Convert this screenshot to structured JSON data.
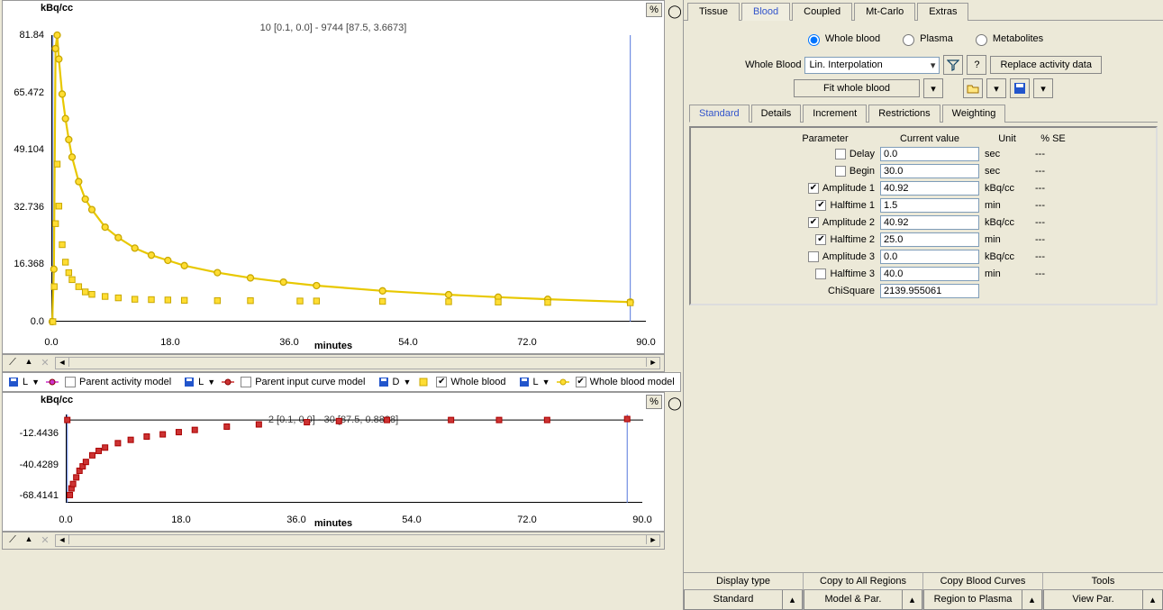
{
  "chart1": {
    "ylabel": "kBq/cc",
    "subtitle": "10 [0.1, 0.0] - 9744 [87.5, 3.6673]",
    "xlabel": "minutes",
    "yticks": [
      "81.84",
      "65.472",
      "49.104",
      "32.736",
      "16.368",
      "0.0"
    ],
    "xticks": [
      "0.0",
      "18.0",
      "36.0",
      "54.0",
      "72.0",
      "90.0"
    ],
    "xrange": [
      0,
      90
    ],
    "yrange": [
      0,
      81.84
    ]
  },
  "chart2": {
    "ylabel": "kBq/cc",
    "subtitle": "2 [0.1, 0.0] - 30 [87.5, 0.8808]",
    "xlabel": "minutes",
    "yticks": [
      "-12.4436",
      "-40.4289",
      "-68.4141"
    ],
    "xticks": [
      "0.0",
      "18.0",
      "36.0",
      "54.0",
      "72.0",
      "90.0"
    ],
    "xrange": [
      0,
      90
    ],
    "yrange": [
      -75,
      5
    ]
  },
  "chart_data": [
    {
      "type": "line",
      "name": "Whole blood model",
      "xlabel": "minutes",
      "ylabel": "kBq/cc",
      "xlim": [
        0,
        90
      ],
      "ylim": [
        0,
        81.84
      ],
      "x": [
        0,
        0.25,
        0.5,
        0.75,
        1,
        1.5,
        2,
        2.5,
        3,
        4,
        5,
        6,
        8,
        10,
        12.5,
        15,
        17.5,
        20,
        25,
        30,
        35,
        40,
        50,
        60,
        67.5,
        75,
        87.5
      ],
      "y": [
        0,
        15,
        78,
        81.84,
        75,
        65,
        58,
        52,
        47,
        40,
        35,
        32,
        27,
        24,
        21,
        19,
        17.5,
        16,
        14,
        12.5,
        11.3,
        10.3,
        8.8,
        7.7,
        7.0,
        6.4,
        5.6
      ]
    },
    {
      "type": "scatter",
      "name": "Whole blood",
      "x": [
        0.1,
        0.3,
        0.5,
        0.75,
        1,
        1.5,
        2,
        2.5,
        3,
        4,
        5,
        6,
        8,
        10,
        12.5,
        15,
        17.5,
        20,
        25,
        30,
        37.5,
        40,
        50,
        60,
        67.5,
        75,
        87.5
      ],
      "y": [
        0,
        10,
        28,
        45,
        33,
        22,
        17,
        14,
        12,
        10,
        8.5,
        7.8,
        7.2,
        6.8,
        6.4,
        6.3,
        6.2,
        6.1,
        6.0,
        6.0,
        5.9,
        5.9,
        5.8,
        5.7,
        5.6,
        5.5,
        5.4
      ]
    },
    {
      "type": "scatter",
      "name": "residuals",
      "xlabel": "minutes",
      "ylabel": "kBq/cc",
      "xlim": [
        0,
        90
      ],
      "ylim": [
        -75,
        5
      ],
      "x": [
        0.1,
        0.5,
        0.75,
        1,
        1.5,
        2,
        2.5,
        3,
        4,
        5,
        6,
        8,
        10,
        12.5,
        15,
        17.5,
        20,
        25,
        30,
        37.5,
        42.5,
        50,
        60,
        67.5,
        75,
        87.5
      ],
      "y": [
        0,
        -68,
        -62,
        -58,
        -52,
        -46,
        -42,
        -38,
        -32,
        -28,
        -25,
        -21,
        -18,
        -15,
        -13,
        -11,
        -9,
        -6,
        -4,
        -2,
        -1,
        0,
        0,
        0,
        0,
        0.88
      ]
    }
  ],
  "legend": [
    {
      "disk": "L",
      "checked": false,
      "label": "Parent activity model",
      "marker": "dot-magenta"
    },
    {
      "disk": "L",
      "checked": false,
      "label": "Parent input curve model",
      "marker": "dot-red"
    },
    {
      "disk": "D",
      "checked": true,
      "label": "Whole blood",
      "marker": "sq-yellow"
    },
    {
      "disk": "L",
      "checked": true,
      "label": "Whole blood model",
      "marker": "dot-yellow"
    }
  ],
  "tabs": [
    "Tissue",
    "Blood",
    "Coupled",
    "Mt-Carlo",
    "Extras"
  ],
  "active_tab": "Blood",
  "radios": [
    "Whole blood",
    "Plasma",
    "Metabolites"
  ],
  "radio_sel": "Whole blood",
  "wb_label": "Whole Blood",
  "wb_method": "Lin. Interpolation",
  "replace_btn": "Replace activity data",
  "fit_btn": "Fit whole blood",
  "subtabs": [
    "Standard",
    "Details",
    "Increment",
    "Restrictions",
    "Weighting"
  ],
  "active_subtab": "Standard",
  "param_hdr": [
    "Parameter",
    "Current value",
    "Unit",
    "% SE"
  ],
  "params": [
    {
      "name": "Delay",
      "chk": false,
      "val": "0.0",
      "unit": "sec",
      "se": "---"
    },
    {
      "name": "Begin",
      "chk": false,
      "val": "30.0",
      "unit": "sec",
      "se": "---"
    },
    {
      "name": "Amplitude 1",
      "chk": true,
      "val": "40.92",
      "unit": "kBq/cc",
      "se": "---"
    },
    {
      "name": "Halftime 1",
      "chk": true,
      "val": "1.5",
      "unit": "min",
      "se": "---"
    },
    {
      "name": "Amplitude 2",
      "chk": true,
      "val": "40.92",
      "unit": "kBq/cc",
      "se": "---"
    },
    {
      "name": "Halftime 2",
      "chk": true,
      "val": "25.0",
      "unit": "min",
      "se": "---"
    },
    {
      "name": "Amplitude 3",
      "chk": false,
      "val": "0.0",
      "unit": "kBq/cc",
      "se": "---"
    },
    {
      "name": "Halftime 3",
      "chk": false,
      "val": "40.0",
      "unit": "min",
      "se": "---"
    }
  ],
  "chisq_label": "ChiSquare",
  "chisq_val": "2139.955061",
  "bottom": [
    {
      "hdr": "Display type",
      "btn": "Standard"
    },
    {
      "hdr": "Copy to All Regions",
      "btn": "Model & Par."
    },
    {
      "hdr": "Copy Blood Curves",
      "btn": "Region to Plasma"
    },
    {
      "hdr": "Tools",
      "btn": "View Par."
    }
  ],
  "pct": "%"
}
